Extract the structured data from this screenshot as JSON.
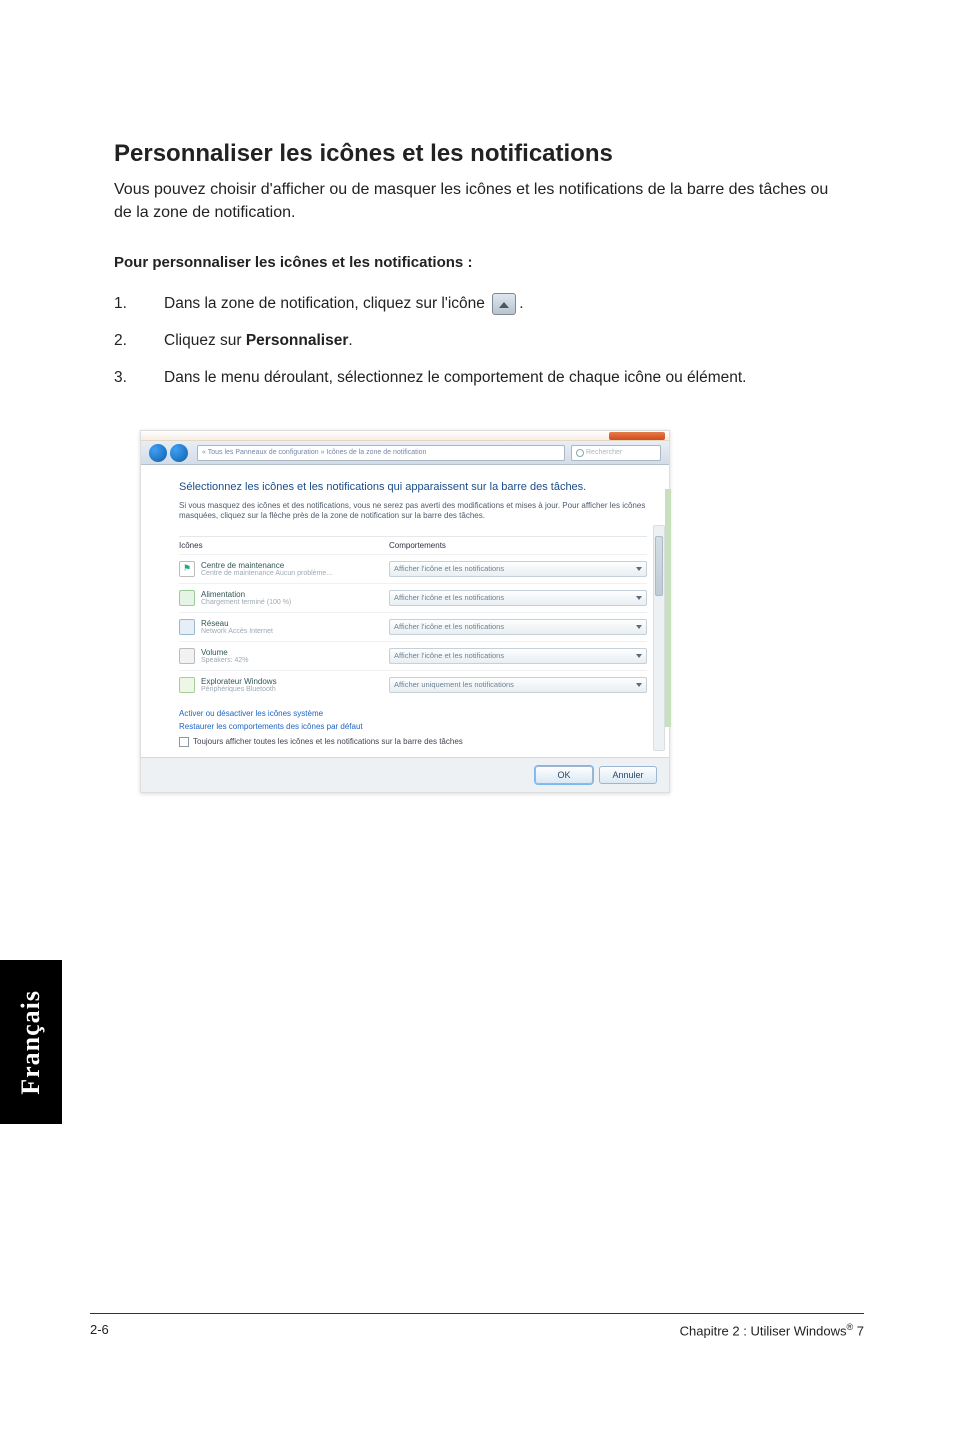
{
  "title": "Personnaliser les icônes et les notifications",
  "intro": "Vous pouvez choisir d'afficher ou de masquer les icônes et les notifications de la barre des tâches ou de la zone de notification.",
  "subheading": "Pour personnaliser les icônes et les notifications :",
  "steps": {
    "1": {
      "num": "1.",
      "pre": "Dans la zone de notification, cliquez sur l'icône",
      "post": "."
    },
    "2": {
      "num": "2.",
      "pre": "Cliquez sur ",
      "bold": "Personnaliser",
      "post": "."
    },
    "3": {
      "num": "3.",
      "text": "Dans le menu déroulant, sélectionnez le comportement de chaque icône ou élément."
    }
  },
  "shot": {
    "address": "« Tous les Panneaux de configuration » Icônes de la zone de notification",
    "search_placeholder": "Rechercher",
    "heading": "Sélectionnez les icônes et les notifications qui apparaissent sur la barre des tâches.",
    "desc": "Si vous masquez des icônes et des notifications, vous ne serez pas averti des modifications et mises à jour. Pour afficher les icônes masquées, cliquez sur la flèche près de la zone de notification sur la barre des tâches.",
    "col1": "Icônes",
    "col2": "Comportements",
    "rows": [
      {
        "l1": "Centre de maintenance",
        "l2": "Centre de maintenance  Aucun problème...",
        "dd": "Afficher l'icône et les notifications",
        "color": "#ffffff"
      },
      {
        "l1": "Alimentation",
        "l2": "Chargement terminé (100 %)",
        "dd": "Afficher l'icône et les notifications",
        "color": "#e6f4e6"
      },
      {
        "l1": "Réseau",
        "l2": "Network  Accès Internet",
        "dd": "Afficher l'icône et les notifications",
        "color": "#e6eef7"
      },
      {
        "l1": "Volume",
        "l2": "Speakers: 42%",
        "dd": "Afficher l'icône et les notifications",
        "color": "#f2f2f2"
      },
      {
        "l1": "Explorateur Windows",
        "l2": "Périphériques Bluetooth",
        "dd": "Afficher uniquement les notifications",
        "color": "#eef7e6"
      }
    ],
    "link1": "Activer ou désactiver les icônes système",
    "link2": "Restaurer les comportements des icônes par défaut",
    "checkbox": "Toujours afficher toutes les icônes et les notifications sur la barre des tâches",
    "ok": "OK",
    "cancel": "Annuler"
  },
  "side_tab": "Français",
  "footer": {
    "left": "2-6",
    "right_pre": "Chapitre 2 : Utiliser Windows",
    "right_sup": "®",
    "right_post": " 7"
  }
}
